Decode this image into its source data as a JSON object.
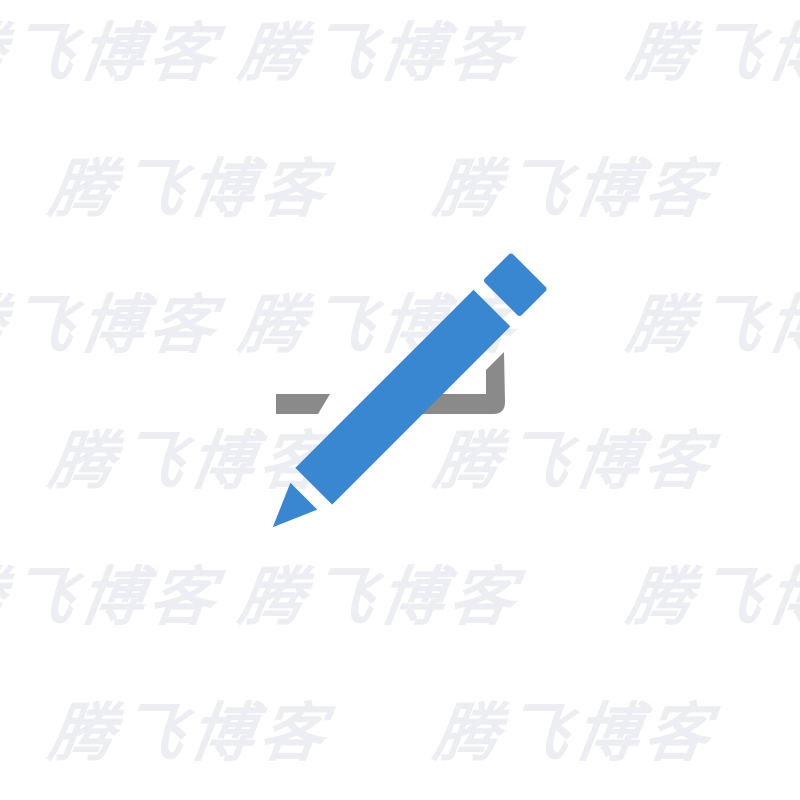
{
  "watermark": {
    "text": "腾飞博客",
    "color": "#eceef3"
  },
  "icon": {
    "name": "edit-pencil-icon",
    "pencil_color": "#3a87d1",
    "baseline_color": "#8a8a8a"
  }
}
